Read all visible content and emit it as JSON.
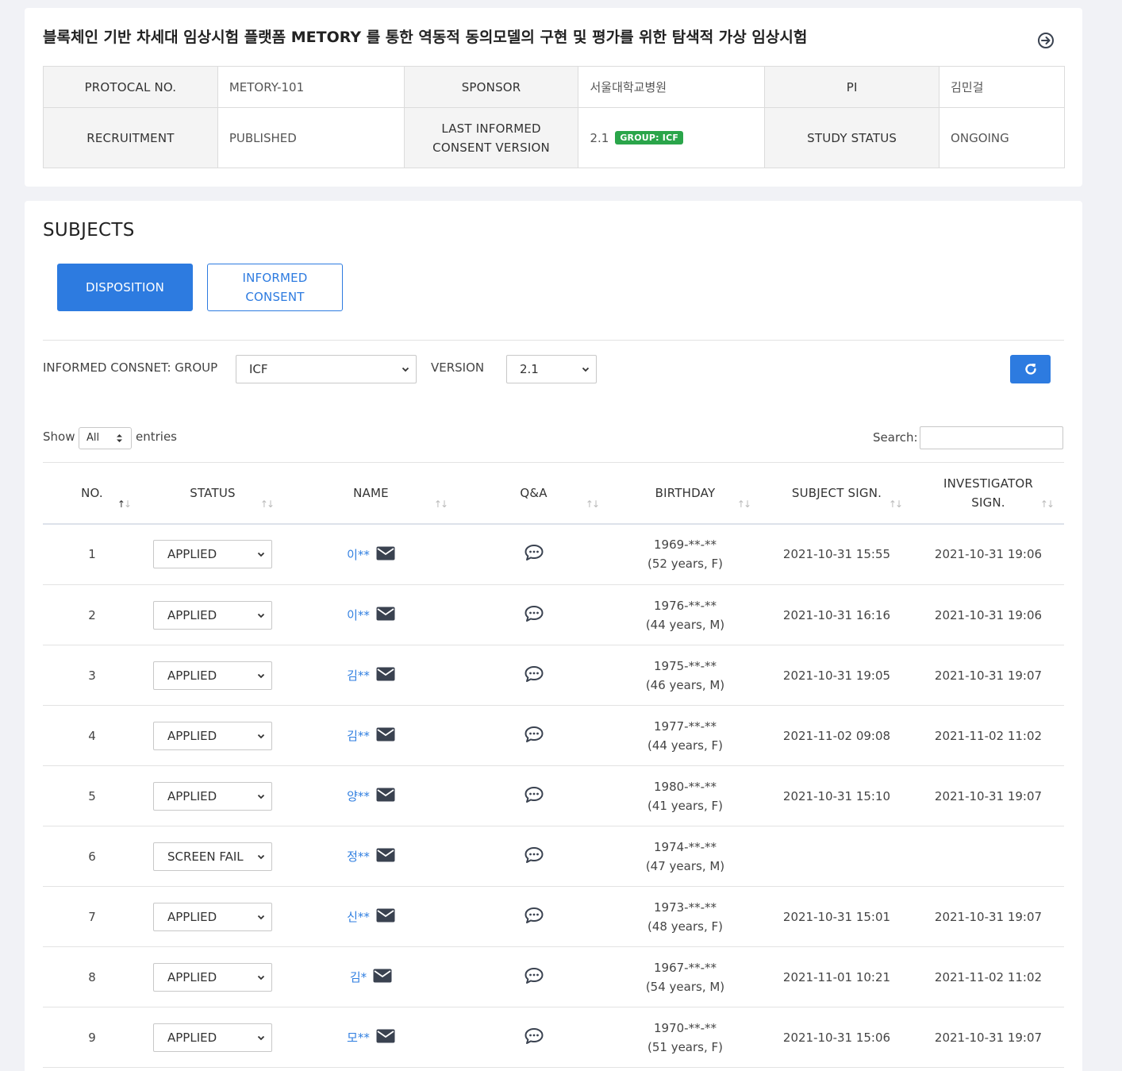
{
  "study": {
    "title": "블록체인 기반 차세대 임상시험 플랫폼 METORY 를 통한 역동적 동의모델의 구현 및 평가를 위한 탐색적 가상 임상시험",
    "labels": {
      "protocol_no": "PROTOCAL NO.",
      "sponsor": "SPONSOR",
      "pi": "PI",
      "recruitment": "RECRUITMENT",
      "last_ic_version_line1": "LAST INFORMED",
      "last_ic_version_line2": "CONSENT VERSION",
      "study_status": "STUDY STATUS"
    },
    "values": {
      "protocol_no": "METORY-101",
      "sponsor": "서울대학교병원",
      "pi": "김민걸",
      "recruitment": "PUBLISHED",
      "last_ic_version": "2.1",
      "group_badge": "GROUP: ICF",
      "study_status": "ONGOING"
    }
  },
  "subjects": {
    "title": "SUBJECTS",
    "tabs": {
      "disposition": "DISPOSITION",
      "informed_consent_line1": "INFORMED",
      "informed_consent_line2": "CONSENT"
    },
    "filters": {
      "group_label": "INFORMED CONSNET: GROUP",
      "group_value": "ICF",
      "version_label": "VERSION",
      "version_value": "2.1"
    },
    "show_label": "Show",
    "show_value": "All",
    "entries_label": "entries",
    "search_label": "Search:",
    "columns": {
      "no": "NO.",
      "status": "STATUS",
      "name": "NAME",
      "qa": "Q&A",
      "birthday": "BIRTHDAY",
      "subject_sign": "SUBJECT SIGN.",
      "investigator_sign_line1": "INVESTIGATOR",
      "investigator_sign_line2": "SIGN."
    },
    "rows": [
      {
        "no": "1",
        "status": "APPLIED",
        "name": "이**",
        "birthday": "1969-**-**",
        "age": "(52 years, F)",
        "subject_sign": "2021-10-31 15:55",
        "investigator_sign": "2021-10-31 19:06"
      },
      {
        "no": "2",
        "status": "APPLIED",
        "name": "이**",
        "birthday": "1976-**-**",
        "age": "(44 years, M)",
        "subject_sign": "2021-10-31 16:16",
        "investigator_sign": "2021-10-31 19:06"
      },
      {
        "no": "3",
        "status": "APPLIED",
        "name": "김**",
        "birthday": "1975-**-**",
        "age": "(46 years, M)",
        "subject_sign": "2021-10-31 19:05",
        "investigator_sign": "2021-10-31 19:07"
      },
      {
        "no": "4",
        "status": "APPLIED",
        "name": "김**",
        "birthday": "1977-**-**",
        "age": "(44 years, F)",
        "subject_sign": "2021-11-02 09:08",
        "investigator_sign": "2021-11-02 11:02"
      },
      {
        "no": "5",
        "status": "APPLIED",
        "name": "양**",
        "birthday": "1980-**-**",
        "age": "(41 years, F)",
        "subject_sign": "2021-10-31 15:10",
        "investigator_sign": "2021-10-31 19:07"
      },
      {
        "no": "6",
        "status": "SCREEN FAIL",
        "name": "정**",
        "birthday": "1974-**-**",
        "age": "(47 years, M)",
        "subject_sign": "",
        "investigator_sign": ""
      },
      {
        "no": "7",
        "status": "APPLIED",
        "name": "신**",
        "birthday": "1973-**-**",
        "age": "(48 years, F)",
        "subject_sign": "2021-10-31 15:01",
        "investigator_sign": "2021-10-31 19:07"
      },
      {
        "no": "8",
        "status": "APPLIED",
        "name": "김*",
        "birthday": "1967-**-**",
        "age": "(54 years, M)",
        "subject_sign": "2021-11-01 10:21",
        "investigator_sign": "2021-11-02 11:02"
      },
      {
        "no": "9",
        "status": "APPLIED",
        "name": "모**",
        "birthday": "1970-**-**",
        "age": "(51 years, F)",
        "subject_sign": "2021-10-31 15:06",
        "investigator_sign": "2021-10-31 19:07"
      }
    ]
  },
  "icons": {
    "goto": "arrow-circle-right-icon",
    "refresh": "refresh-icon",
    "mail": "envelope-icon",
    "chat": "chat-bubble-icon",
    "sort": "sort-icon",
    "chevron": "chevron-down-icon"
  },
  "colors": {
    "primary": "#2d7be0",
    "link": "#2f7ee0",
    "badge": "#2aa54a",
    "icon_dark": "#3a4250"
  }
}
